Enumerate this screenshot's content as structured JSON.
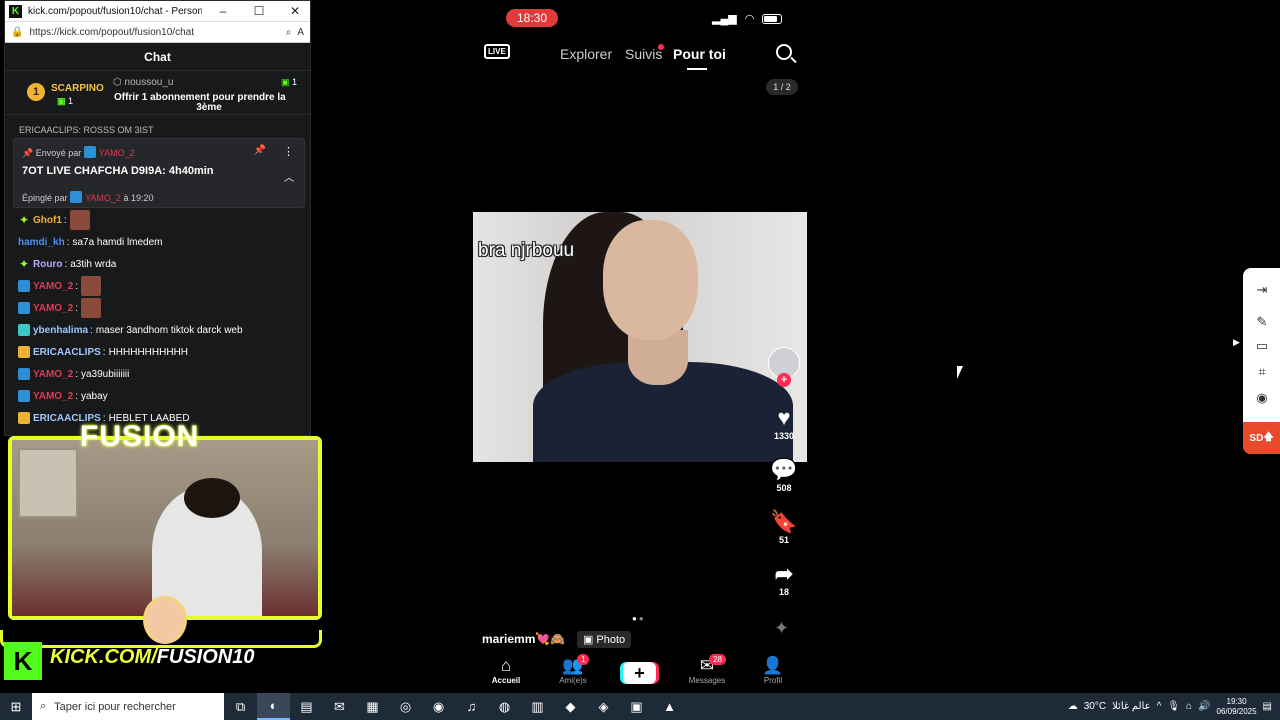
{
  "browser": {
    "title": "kick.com/popout/fusion10/chat - Personal - Microsoft…",
    "url": "https://kick.com/popout/fusion10/chat",
    "min_icon": "minimize-icon",
    "max_icon": "maximize-icon",
    "close_icon": "close-icon"
  },
  "chat": {
    "header": "Chat",
    "leaderboard": {
      "rank": "1",
      "user": "SCARPINO",
      "count": "1"
    },
    "gift": {
      "user": "noussou_u",
      "count": "1",
      "text": "Offrir 1 abonnement pour prendre la",
      "text2": "3ème"
    },
    "partial_line": "ERICAACLIPS: ROSSS OM 3IST",
    "pinned": {
      "sent_by_label": "Envoyé par",
      "sent_by_user": "YAMO_2",
      "message": "7OT LIVE CHAFCHA D9I9A: 4h40min",
      "pinned_by_label": "Épinglé par",
      "pinned_by_user": "YAMO_2",
      "pinned_time": "à 19:20"
    },
    "messages": [
      {
        "user": "Ghof1",
        "text": "",
        "emote": true,
        "color": "#f0b232"
      },
      {
        "user": "hamdi_kh",
        "text": "sa7a hamdi lmedem",
        "emote": false,
        "color": "#4f8ef7"
      },
      {
        "user": "Rouro",
        "text": "a3tih wrda",
        "emote": false,
        "color": "#b8a7ff"
      },
      {
        "user": "YAMO_2",
        "text": "",
        "emote": true,
        "color": "#e03a52"
      },
      {
        "user": "YAMO_2",
        "text": "",
        "emote": true,
        "color": "#e03a52"
      },
      {
        "user": "ybenhalima",
        "text": "maser 3andhom tiktok darck web",
        "emote": false,
        "color": "#9fc8ff"
      },
      {
        "user": "ERICAACLIPS",
        "text": "HHHHHHHHHHH",
        "emote": false,
        "color": "#9fc8ff"
      },
      {
        "user": "YAMO_2",
        "text": "ya39ubiiiiiii",
        "emote": false,
        "color": "#e03a52"
      },
      {
        "user": "YAMO_2",
        "text": "yabay",
        "emote": false,
        "color": "#e03a52"
      },
      {
        "user": "ERICAACLIPS",
        "text": "HEBLET LAABED",
        "emote": false,
        "color": "#9fc8ff"
      }
    ]
  },
  "overlay": {
    "fusion": "FUSION",
    "kick_domain": "KICK.COM/",
    "kick_channel": "FUSION10",
    "kick_logo": "K"
  },
  "phone": {
    "time": "18:30",
    "nav": {
      "live": "LIVE",
      "explorer": "Explorer",
      "suivis": "Suivis",
      "pour_toi": "Pour toi"
    },
    "pager": "1 / 2",
    "caption": "bra njrbouu",
    "likes": "1330",
    "comments": "508",
    "saves": "51",
    "shares": "18",
    "author": "mariemm💘🙈",
    "photo_tag": "Photo",
    "bottom": {
      "accueil": "Accueil",
      "amis": "Ami(e)s",
      "amis_badge": "1",
      "messages": "Messages",
      "messages_badge": "28",
      "profil": "Profil"
    }
  },
  "toolbar": {
    "sd": "SD"
  },
  "taskbar": {
    "search_placeholder": "Taper ici pour rechercher",
    "temperature": "30°C",
    "weather_text": "عالم غائلا",
    "time": "19:30",
    "date": "06/09/2025"
  }
}
